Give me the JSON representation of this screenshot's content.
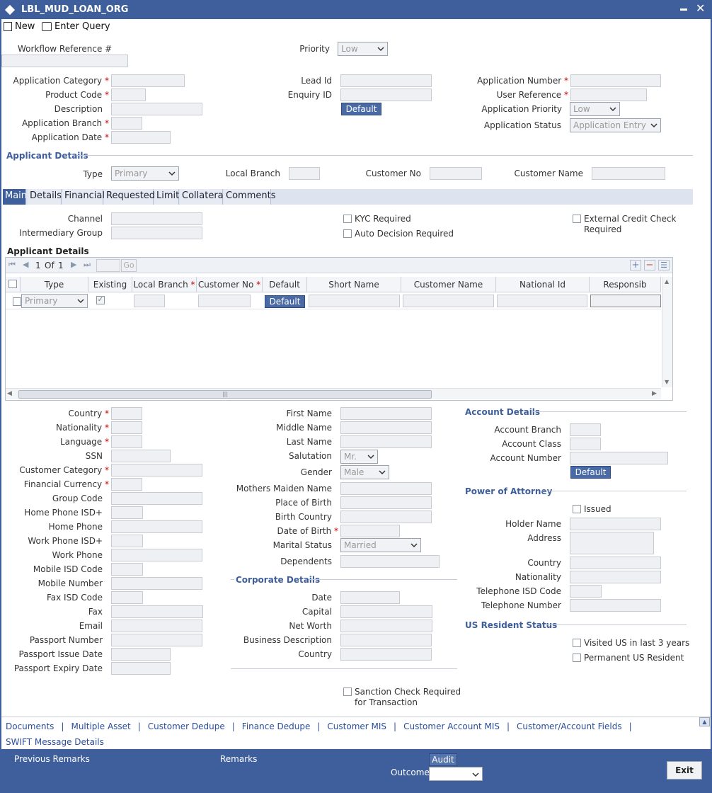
{
  "window": {
    "title": "LBL_MUD_LOAN_ORG"
  },
  "toolbar": {
    "new": "New",
    "enter_query": "Enter Query"
  },
  "header": {
    "workflow_ref": "Workflow Reference #",
    "priority": "Priority",
    "priority_value": "Low",
    "app_category": "Application Category",
    "product_code": "Product Code",
    "description": "Description",
    "app_branch": "Application Branch",
    "app_date": "Application Date",
    "lead_id": "Lead Id",
    "enquiry_id": "Enquiry ID",
    "default": "Default",
    "app_number": "Application Number",
    "user_reference": "User Reference",
    "app_priority": "Application Priority",
    "app_priority_value": "Low",
    "app_status": "Application Status",
    "app_status_value": "Application Entry"
  },
  "applicant_details": {
    "title": "Applicant Details",
    "type": "Type",
    "type_value": "Primary",
    "local_branch": "Local Branch",
    "customer_no": "Customer No",
    "customer_name": "Customer Name"
  },
  "tabs": [
    "Main",
    "Details",
    "Financial",
    "Requested",
    "Limit",
    "Collateral",
    "Comments"
  ],
  "main": {
    "channel": "Channel",
    "intermediary_group": "Intermediary Group",
    "kyc_required": "KYC Required",
    "auto_decision": "Auto Decision Required",
    "ext_credit_1": "External Credit Check",
    "ext_credit_2": "Required"
  },
  "grid": {
    "title": "Applicant Details",
    "page": "1",
    "of": "Of",
    "total": "1",
    "go": "Go",
    "headers": [
      "Type",
      "Existing",
      "Local Branch",
      "Customer No",
      "Default",
      "Short Name",
      "Customer Name",
      "National Id",
      "Responsib"
    ],
    "row_type": "Primary",
    "row_default": "Default"
  },
  "left_col": [
    "Country",
    "Nationality",
    "Language",
    "SSN",
    "Customer Category",
    "Financial Currency",
    "Group Code",
    "Home Phone ISD+",
    "Home Phone",
    "Work Phone ISD+",
    "Work Phone",
    "Mobile ISD Code",
    "Mobile Number",
    "Fax ISD Code",
    "Fax",
    "Email",
    "Passport Number",
    "Passport Issue Date",
    "Passport Expiry Date"
  ],
  "mid_col": {
    "first_name": "First Name",
    "middle_name": "Middle Name",
    "last_name": "Last Name",
    "salutation": "Salutation",
    "salutation_value": "Mr.",
    "gender": "Gender",
    "gender_value": "Male",
    "mothers_maiden": "Mothers Maiden Name",
    "place_of_birth": "Place of Birth",
    "birth_country": "Birth Country",
    "dob": "Date of Birth",
    "marital_status": "Marital Status",
    "marital_value": "Married",
    "dependents": "Dependents"
  },
  "corporate": {
    "title": "Corporate Details",
    "date": "Date",
    "capital": "Capital",
    "net_worth": "Net Worth",
    "business_desc": "Business Description",
    "country": "Country"
  },
  "account": {
    "title": "Account Details",
    "branch": "Account Branch",
    "class": "Account Class",
    "number": "Account Number",
    "default": "Default"
  },
  "poa": {
    "title": "Power of Attorney",
    "issued": "Issued",
    "holder": "Holder Name",
    "address": "Address",
    "country": "Country",
    "nationality": "Nationality",
    "tel_isd": "Telephone ISD Code",
    "tel_no": "Telephone Number"
  },
  "us": {
    "title": "US Resident Status",
    "visited": "Visited US in last 3 years",
    "permanent": "Permanent US Resident"
  },
  "sanction": {
    "line1": "Sanction Check Required",
    "line2": "for Transaction"
  },
  "links": [
    "Documents",
    "Multiple Asset",
    "Customer Dedupe",
    "Finance Dedupe",
    "Customer MIS",
    "Customer Account MIS",
    "Customer/Account Fields",
    "SWIFT Message Details"
  ],
  "bottom": {
    "prev_remarks": "Previous Remarks",
    "remarks": "Remarks",
    "audit": "Audit",
    "outcome": "Outcome",
    "exit": "Exit"
  },
  "colors": {
    "title_bar": "#3e5f9b",
    "section": "#3e5f9b",
    "link": "#2a4d9c",
    "required": "#cc0000"
  }
}
